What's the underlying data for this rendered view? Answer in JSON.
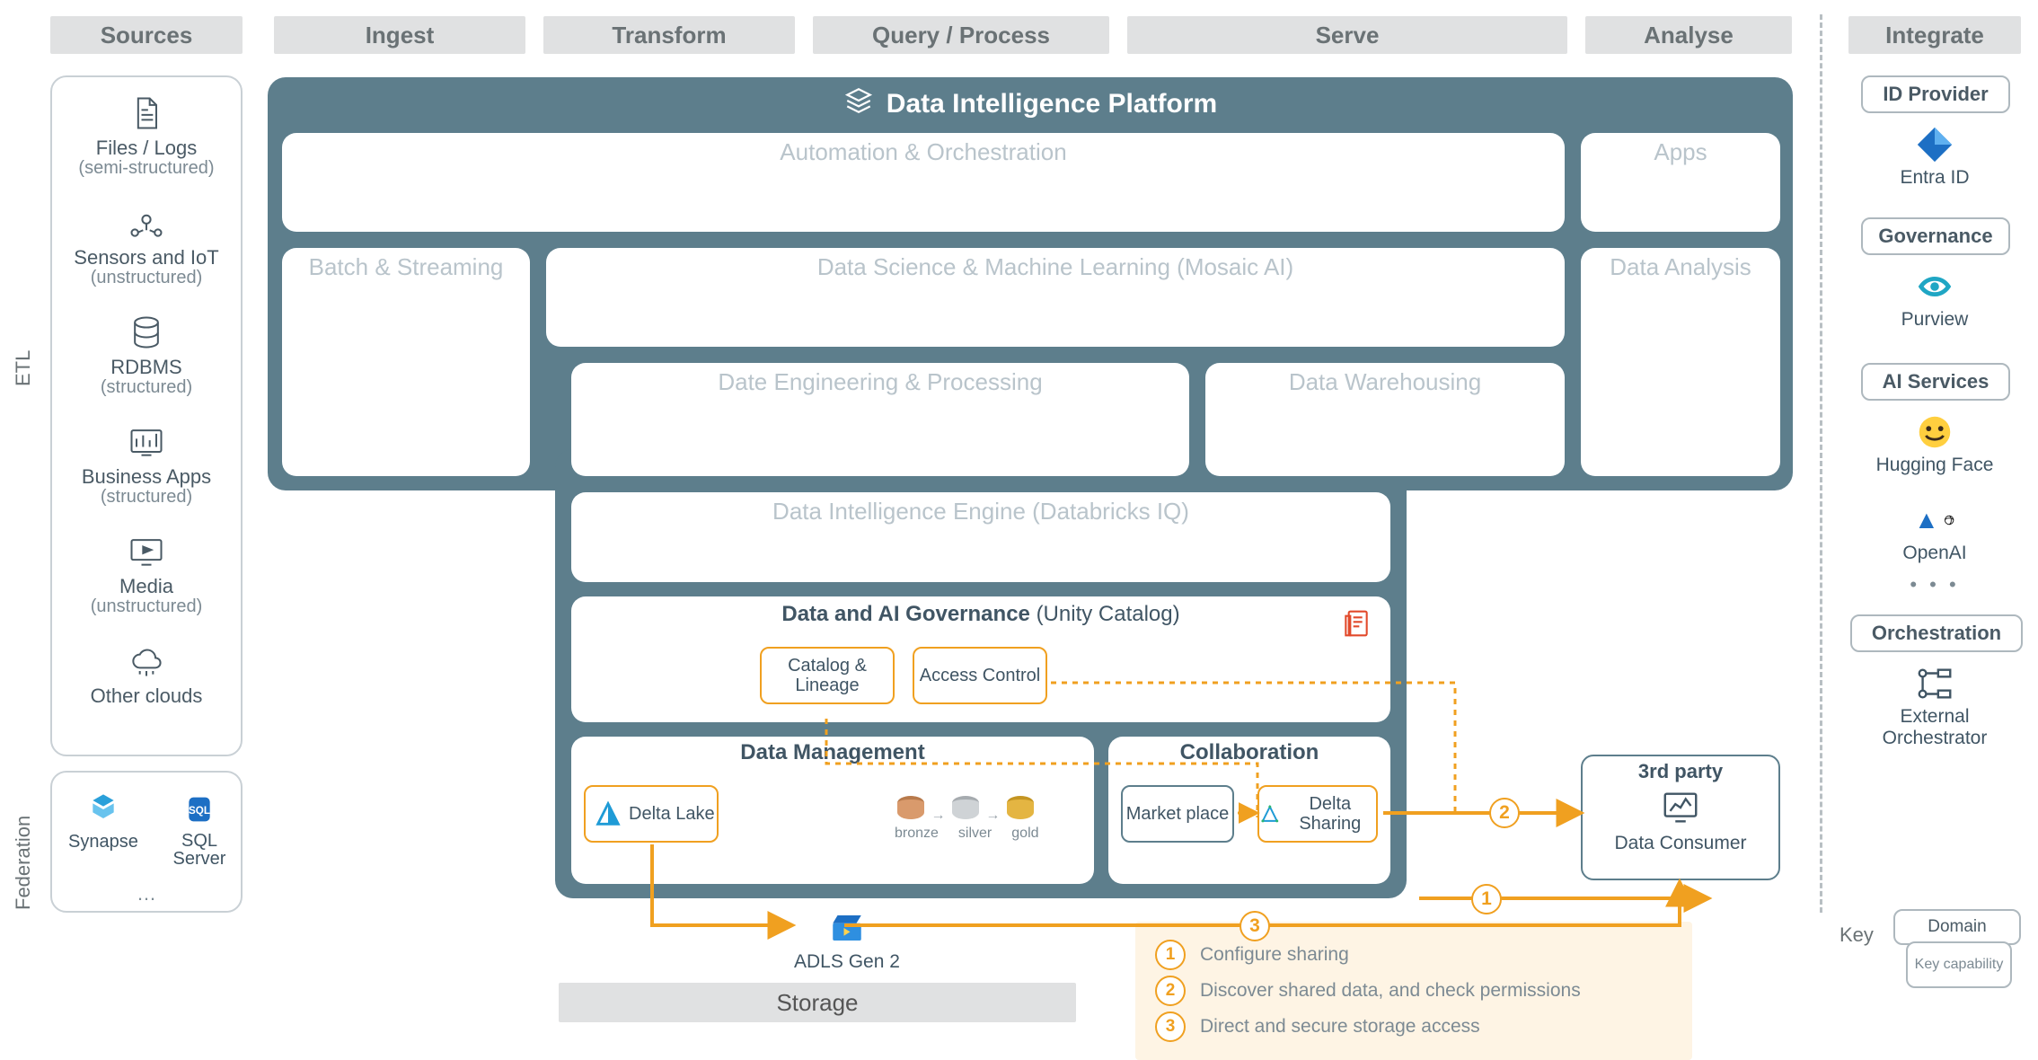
{
  "headers": {
    "sources": "Sources",
    "ingest": "Ingest",
    "transform": "Transform",
    "query": "Query / Process",
    "serve": "Serve",
    "analyse": "Analyse",
    "integrate": "Integrate"
  },
  "side_labels": {
    "etl": "ETL",
    "federation": "Federation"
  },
  "sources": {
    "items": [
      {
        "title": "Files / Logs",
        "sub": "(semi-structured)"
      },
      {
        "title": "Sensors and IoT",
        "sub": "(unstructured)"
      },
      {
        "title": "RDBMS",
        "sub": "(structured)"
      },
      {
        "title": "Business Apps",
        "sub": "(structured)"
      },
      {
        "title": "Media",
        "sub": "(unstructured)"
      },
      {
        "title": "Other clouds",
        "sub": ""
      }
    ],
    "federation": {
      "synapse": "Synapse",
      "sqlserver": "SQL Server",
      "more": "…"
    }
  },
  "platform": {
    "title": "Data Intelligence Platform",
    "automation": "Automation & Orchestration",
    "apps": "Apps",
    "batch": "Batch & Streaming",
    "dsml": "Data Science & Machine Learning  (Mosaic AI)",
    "data_analysis": "Data Analysis",
    "de_processing": "Date Engineering & Processing",
    "warehousing": "Data Warehousing",
    "engine": "Data Intelligence Engine  (Databricks IQ)",
    "governance": {
      "title_a": "Data and AI Governance",
      "title_b": "(Unity Catalog)",
      "catalog": "Catalog & Lineage",
      "access": "Access Control"
    },
    "data_mgmt": {
      "title": "Data Management",
      "delta_lake": "Delta Lake",
      "bronze": "bronze",
      "silver": "silver",
      "gold": "gold"
    },
    "collab": {
      "title": "Collaboration",
      "marketplace": "Market place",
      "delta_sharing": "Delta Sharing"
    }
  },
  "third_party": {
    "title": "3rd party",
    "consumer": "Data Consumer"
  },
  "storage": {
    "adls": "ADLS Gen 2",
    "label": "Storage"
  },
  "steps": {
    "s1": "Configure sharing",
    "s2": "Discover shared data, and check permissions",
    "s3": "Direct and secure storage access"
  },
  "integrate": {
    "id_provider": "ID Provider",
    "entra": "Entra ID",
    "governance": "Governance",
    "purview": "Purview",
    "ai_services": "AI Services",
    "hugging": "Hugging Face",
    "openai": "OpenAI",
    "orchestration": "Orchestration",
    "ext_orch": "External Orchestrator",
    "more": "• • •"
  },
  "key": {
    "label": "Key",
    "domain": "Domain",
    "capability": "Key capability"
  }
}
